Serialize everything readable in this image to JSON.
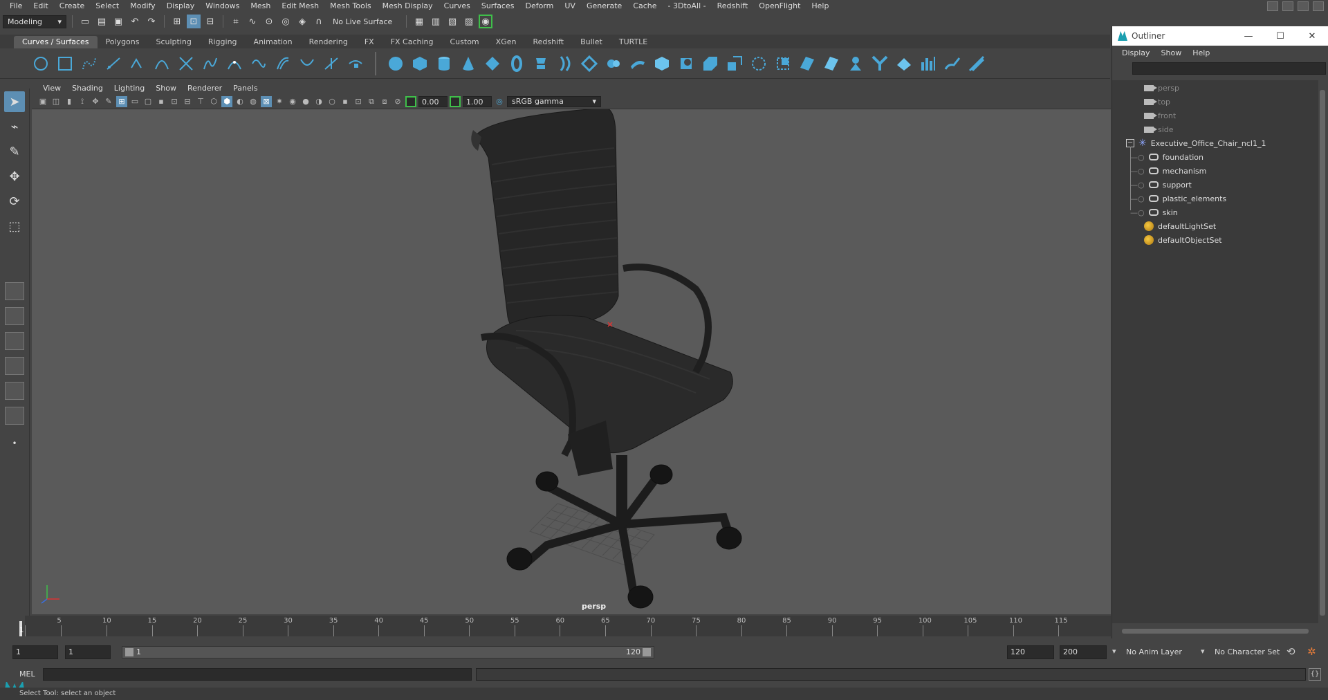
{
  "menubar": {
    "items": [
      "File",
      "Edit",
      "Create",
      "Select",
      "Modify",
      "Display",
      "Windows",
      "Mesh",
      "Edit Mesh",
      "Mesh Tools",
      "Mesh Display",
      "Curves",
      "Surfaces",
      "Deform",
      "UV",
      "Generate",
      "Cache",
      "- 3DtoAll -",
      "Redshift",
      "OpenFlight",
      "Help"
    ]
  },
  "statusline": {
    "workspace": "Modeling",
    "live_surface": "No Live Surface"
  },
  "shelf": {
    "tabs": [
      "Curves / Surfaces",
      "Polygons",
      "Sculpting",
      "Rigging",
      "Animation",
      "Rendering",
      "FX",
      "FX Caching",
      "Custom",
      "XGen",
      "Redshift",
      "Bullet",
      "TURTLE"
    ],
    "active_tab": "Curves / Surfaces",
    "accent": "#4aa8d8"
  },
  "panel": {
    "menu": [
      "View",
      "Shading",
      "Lighting",
      "Show",
      "Renderer",
      "Panels"
    ],
    "exposure": "0.00",
    "gamma": "1.00",
    "color_space": "sRGB gamma",
    "camera_label": "persp"
  },
  "outliner": {
    "title": "Outliner",
    "menu": [
      "Display",
      "Show",
      "Help"
    ],
    "cameras": [
      "persp",
      "top",
      "front",
      "side"
    ],
    "group": "Executive_Office_Chair_ncl1_1",
    "children": [
      "foundation",
      "mechanism",
      "support",
      "plastic_elements",
      "skin"
    ],
    "sets": [
      "defaultLightSet",
      "defaultObjectSet"
    ]
  },
  "timeline": {
    "ticks": [
      1,
      5,
      10,
      15,
      20,
      25,
      30,
      35,
      40,
      45,
      50,
      55,
      60,
      65,
      70,
      75,
      80,
      85,
      90,
      95,
      100,
      105,
      110,
      115
    ],
    "current_frame": 1
  },
  "range": {
    "start": "1",
    "current": "1",
    "slider_start": "1",
    "slider_end": "120",
    "end": "120",
    "max": "200",
    "anim_layer": "No Anim Layer",
    "character_set": "No Character Set"
  },
  "cmdline": {
    "label": "MEL"
  },
  "helpline": {
    "text": "Select Tool: select an object"
  }
}
